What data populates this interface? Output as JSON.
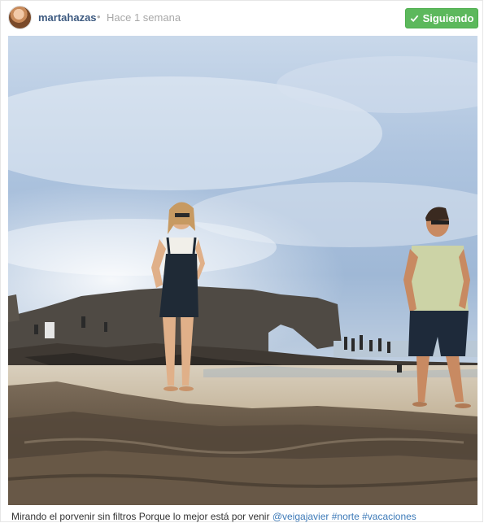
{
  "post": {
    "username": "martahazas",
    "separator": "•",
    "timestamp": "Hace 1 semana",
    "follow_label": "Siguiendo",
    "caption": {
      "text": "Mirando el porvenir sin filtros Porque lo mejor está por venir",
      "mention": "@veigajavier",
      "hashtags": [
        "#norte",
        "#vacaciones"
      ]
    }
  },
  "icons": {
    "follow_check": "check-icon",
    "user_tag": "user-tag-icon"
  },
  "colors": {
    "follow_button": "#5cb85c",
    "username": "#3d5a80",
    "link": "#3d7ab8"
  }
}
